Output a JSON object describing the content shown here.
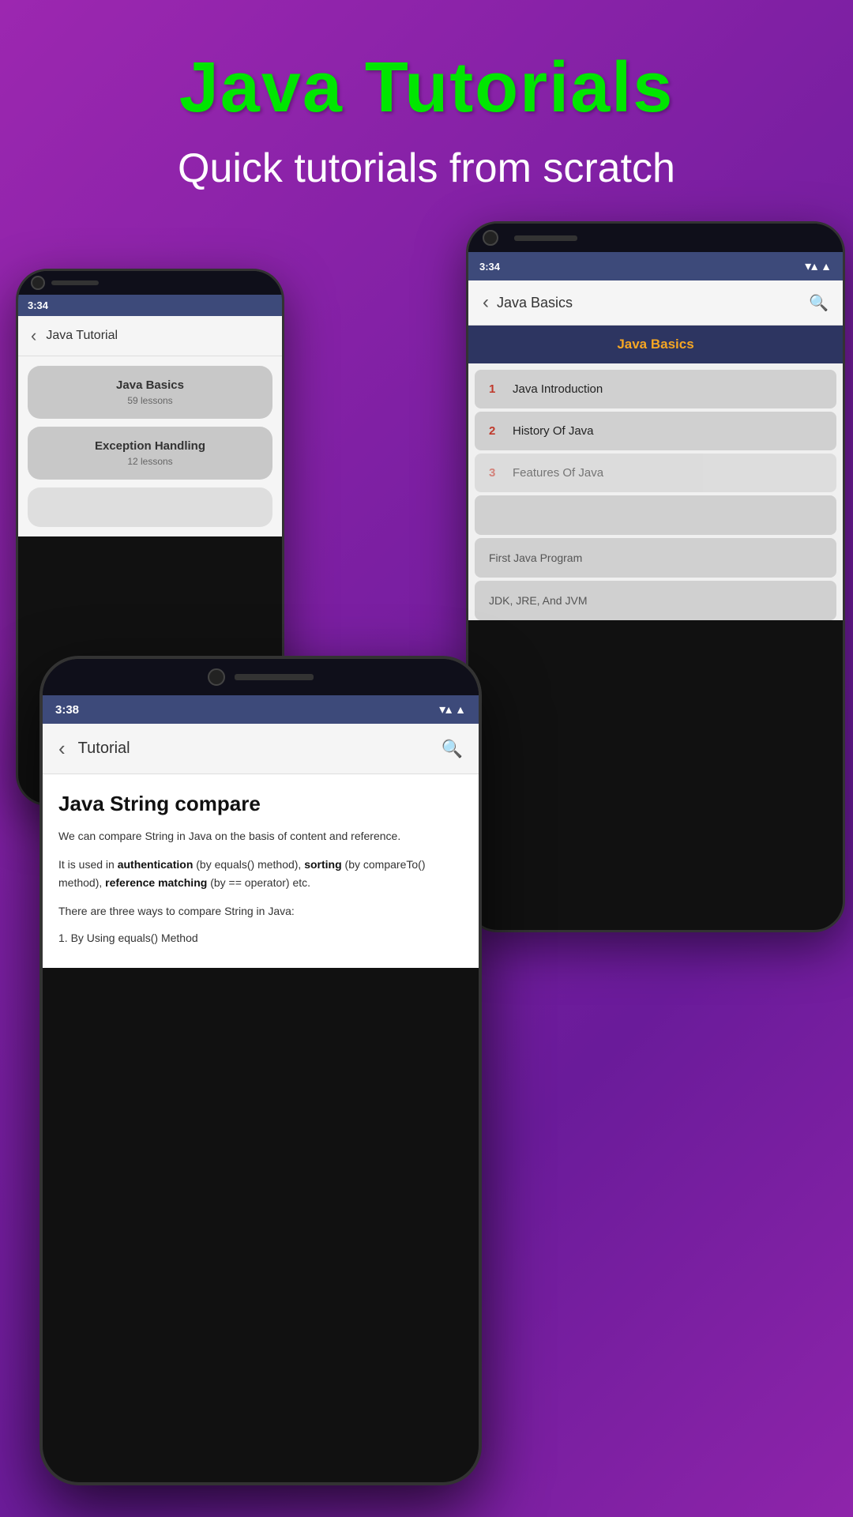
{
  "app": {
    "title": "Java Tutorials",
    "subtitle": "Quick tutorials from scratch"
  },
  "phone1": {
    "time": "3:34",
    "header_title": "Java Tutorial",
    "categories": [
      {
        "title": "Java Basics",
        "subtitle": "59 lessons"
      },
      {
        "title": "Exception Handling",
        "subtitle": "12 lessons"
      }
    ]
  },
  "phone2": {
    "time": "3:34",
    "header_title": "Java Basics",
    "section_header": "Java Basics",
    "lessons": [
      {
        "number": "1",
        "title": "Java Introduction"
      },
      {
        "number": "2",
        "title": "History Of Java"
      },
      {
        "number": "3",
        "title": "Features Of Java"
      }
    ],
    "partial_items": [
      "First Java Program",
      "JDK, JRE, And JVM"
    ]
  },
  "phone3": {
    "time": "3:38",
    "header_title": "Tutorial",
    "content": {
      "title": "Java String compare",
      "para1": "We can compare String in Java on the basis of content and reference.",
      "para2": "It is used in authentication (by equals() method), sorting (by compareTo() method), reference matching (by == operator) etc.",
      "para3": "There are three ways to compare String in Java:",
      "list_item1": "1. By Using equals() Method"
    }
  },
  "colors": {
    "accent_green": "#00e600",
    "header_purple": "#3d4a7a",
    "section_dark": "#2d3561",
    "orange": "#f5a623",
    "red_number": "#c0392b"
  },
  "icons": {
    "back_arrow": "‹",
    "search": "🔍",
    "wifi": "▾▴",
    "signal": "▲"
  }
}
